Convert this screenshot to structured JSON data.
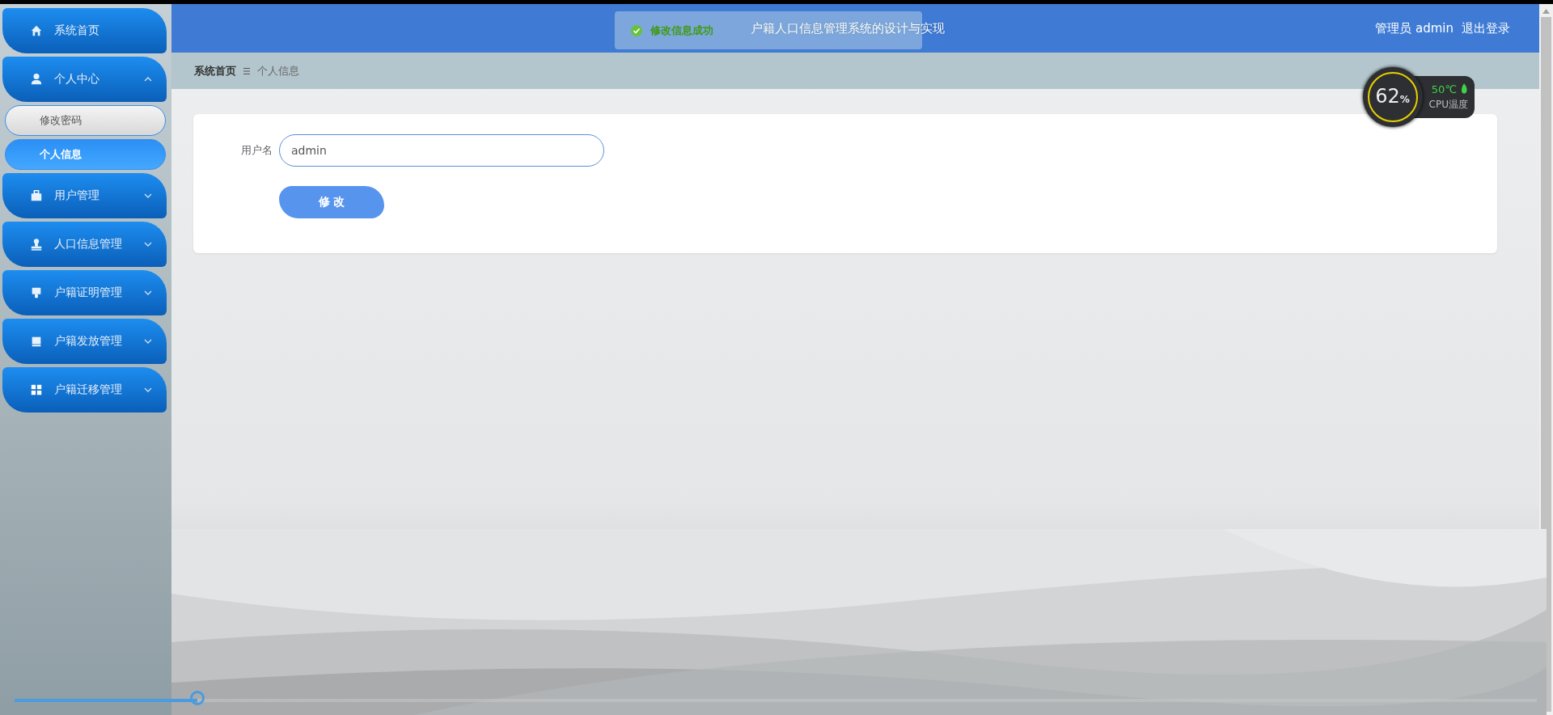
{
  "header": {
    "title": "户籍人口信息管理系统的设计与实现",
    "user": "管理员 admin",
    "logout": "退出登录"
  },
  "toast": {
    "kind": "success",
    "message": "修改信息成功"
  },
  "sidebar": {
    "items": [
      {
        "label": "系统首页",
        "kind": "link"
      },
      {
        "label": "个人中心",
        "kind": "group",
        "expanded": true,
        "children": [
          {
            "label": "修改密码",
            "selected": false
          },
          {
            "label": "个人信息",
            "selected": true
          }
        ]
      },
      {
        "label": "用户管理",
        "kind": "group",
        "expanded": false
      },
      {
        "label": "人口信息管理",
        "kind": "group",
        "expanded": false
      },
      {
        "label": "户籍证明管理",
        "kind": "group",
        "expanded": false
      },
      {
        "label": "户籍发放管理",
        "kind": "group",
        "expanded": false
      },
      {
        "label": "户籍迁移管理",
        "kind": "group",
        "expanded": false
      }
    ]
  },
  "breadcrumb": [
    "系统首页",
    "个人信息"
  ],
  "form": {
    "fields": [
      {
        "label": "用户名",
        "value": "admin"
      }
    ],
    "submit": "修 改"
  },
  "cpu_widget": {
    "percent": "62",
    "unit": "%",
    "temperature": "50℃",
    "label": "CPU温度"
  },
  "video_progress": {
    "level": 0.12
  }
}
